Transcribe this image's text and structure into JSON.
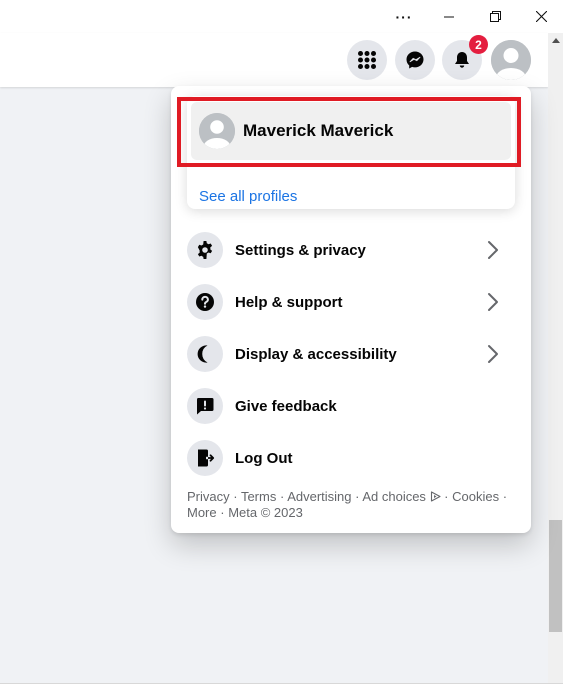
{
  "window_controls": {
    "more": "···",
    "minimize": "minimize",
    "restore": "restore",
    "close": "close"
  },
  "header": {
    "menu_icon": "grid-menu-icon",
    "messenger_icon": "messenger-icon",
    "notifications_icon": "bell-icon",
    "notification_count": "2",
    "account_icon": "avatar"
  },
  "profile": {
    "name": "Maverick Maverick",
    "see_all": "See all profiles"
  },
  "menu": {
    "items": [
      {
        "label": "Settings & privacy",
        "icon": "gear-icon",
        "has_submenu": true
      },
      {
        "label": "Help & support",
        "icon": "question-icon",
        "has_submenu": true
      },
      {
        "label": "Display & accessibility",
        "icon": "moon-icon",
        "has_submenu": true
      },
      {
        "label": "Give feedback",
        "icon": "feedback-icon",
        "has_submenu": false
      },
      {
        "label": "Log Out",
        "icon": "logout-icon",
        "has_submenu": false
      }
    ]
  },
  "footer": {
    "links": [
      "Privacy",
      "Terms",
      "Advertising",
      "Ad choices",
      "Cookies",
      "More"
    ],
    "separator": " · ",
    "copyright": "Meta © 2023"
  },
  "colors": {
    "highlight": "#e01b24",
    "link": "#1b74e4",
    "badge": "#e41e3f",
    "page_bg": "#f0f2f5"
  }
}
